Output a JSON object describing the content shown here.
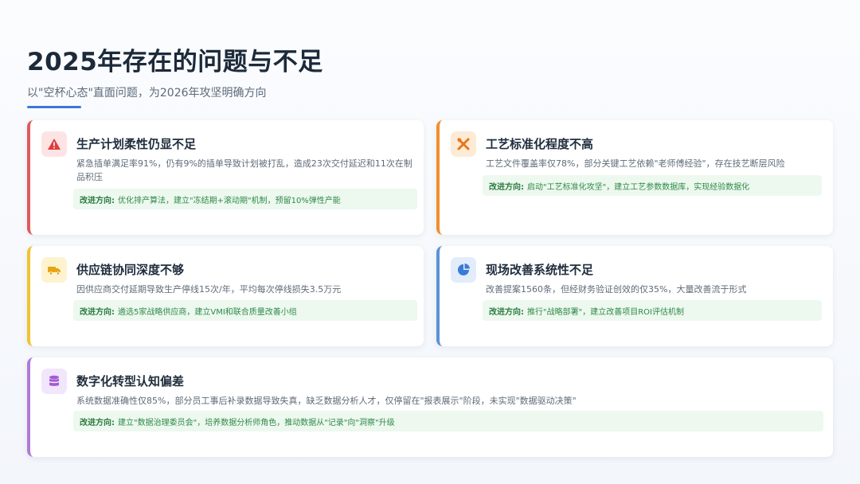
{
  "header": {
    "title": "2025年存在的问题与不足",
    "subtitle": "以\"空杯心态\"直面问题，为2026年攻坚明确方向"
  },
  "colors": {
    "accent": "#3a7bd5",
    "card1": "#e05b5b",
    "card2": "#ef8f2e",
    "card3": "#f2c230",
    "card4": "#5b92d9",
    "card5": "#b07ad8",
    "tip_bg": "#edf8ef",
    "tip_text": "#2f8a48"
  },
  "cards": [
    {
      "icon": "warning-icon",
      "title": "生产计划柔性仍显不足",
      "desc": "紧急插单满足率91%，仍有9%的插单导致计划被打乱，造成23次交付延迟和11次在制品积压",
      "tip_label": "改进方向:",
      "tip_text": "优化排产算法，建立\"冻结期+滚动期\"机制，预留10%弹性产能"
    },
    {
      "icon": "tools-icon",
      "title": "工艺标准化程度不高",
      "desc": "工艺文件覆盖率仅78%，部分关键工艺依赖\"老师傅经验\"，存在技艺断层风险",
      "tip_label": "改进方向:",
      "tip_text": "启动\"工艺标准化攻坚\"，建立工艺参数数据库，实现经验数据化"
    },
    {
      "icon": "truck-icon",
      "title": "供应链协同深度不够",
      "desc": "因供应商交付延期导致生产停线15次/年，平均每次停线损失3.5万元",
      "tip_label": "改进方向:",
      "tip_text": "遴选5家战略供应商，建立VMI和联合质量改善小组"
    },
    {
      "icon": "pie-chart-icon",
      "title": "现场改善系统性不足",
      "desc": "改善提案1560条，但经财务验证创效的仅35%，大量改善流于形式",
      "tip_label": "改进方向:",
      "tip_text": "推行\"战略部署\"，建立改善项目ROI评估机制"
    },
    {
      "icon": "database-icon",
      "title": "数字化转型认知偏差",
      "desc": "系统数据准确性仅85%，部分员工事后补录数据导致失真，缺乏数据分析人才，仅停留在\"报表展示\"阶段，未实现\"数据驱动决策\"",
      "tip_label": "改进方向:",
      "tip_text": "建立\"数据治理委员会\"，培养数据分析师角色，推动数据从\"记录\"向\"洞察\"升级"
    }
  ]
}
